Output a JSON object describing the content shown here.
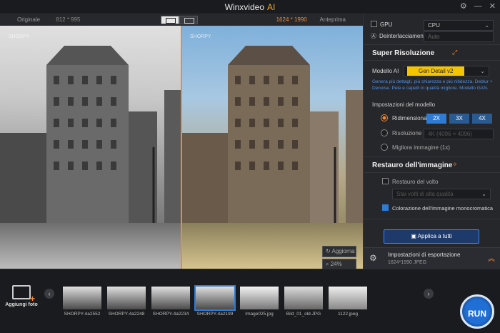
{
  "app": {
    "title": "Winxvideo",
    "title_accent": "AI"
  },
  "compare": {
    "left_label": "Originale",
    "left_dim": "812 * 995",
    "right_dim": "1624 * 1990",
    "right_label": "Anteprima",
    "watermark": "SHORPY"
  },
  "viewer_controls": {
    "refresh": "Aggiorna",
    "zoom": "24%"
  },
  "panel": {
    "gpu_label": "GPU",
    "gpu_value": "CPU",
    "deinterlace_label": "Deinterlacciamento",
    "deinterlace_value": "Auto",
    "super_res": {
      "title": "Super Risoluzione",
      "model_label": "Modello AI",
      "model_value": "Gen Detail v2",
      "description": "Genera più dettagli, più chiarezza e più nitidezza. Deblur + Denoise. Pele e capelli in qualità migliore. Modello GAN.",
      "settings_label": "Impostazioni del modello",
      "resize_label": "Ridimensiona",
      "scales": [
        "2X",
        "3X",
        "4X"
      ],
      "resolution_label": "Risoluzione",
      "resolution_value": "4K (4096 × 4096)",
      "enhance_label": "Migliora immagine (1x)"
    },
    "restore": {
      "title": "Restauro dell'immagine",
      "face_label": "Restauro del volto",
      "face_value": "Stai volti di alta qualità",
      "color_label": "Colorazione dell'immagine monocromatica"
    },
    "apply_all": "Applica a tutti",
    "export": {
      "title": "Impostazioni di esportazione",
      "info": "1624*1990  JPEG"
    }
  },
  "bottom": {
    "add_label": "Aggiungi foto",
    "thumbnails": [
      {
        "name": "SHORPY-4a2552"
      },
      {
        "name": "SHORPY-4a2248"
      },
      {
        "name": "SHORPY-4a2234"
      },
      {
        "name": "SHORPY-4a2199"
      },
      {
        "name": "Image025.jpg"
      },
      {
        "name": "Bild_01_old.JPG"
      },
      {
        "name": "1122.jpeg"
      }
    ],
    "run_label": "RUN"
  }
}
